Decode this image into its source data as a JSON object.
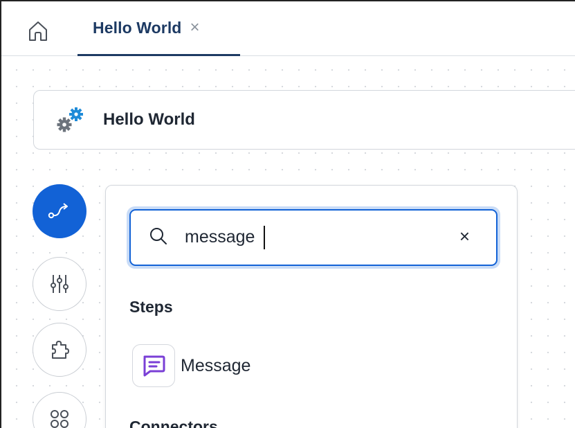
{
  "tabs": {
    "home_icon": "home-icon",
    "active_tab": {
      "label": "Hello World",
      "close": "×"
    }
  },
  "flow": {
    "icon": "cogs-icon",
    "title": "Hello World"
  },
  "rail": {
    "items": [
      {
        "icon": "flow-path-icon",
        "active": true
      },
      {
        "icon": "sliders-icon",
        "active": false
      },
      {
        "icon": "puzzle-icon",
        "active": false
      },
      {
        "icon": "apps-grid-icon",
        "active": false
      }
    ]
  },
  "search": {
    "value": "message",
    "clear": "×"
  },
  "sections": {
    "steps": "Steps",
    "connectors": "Connectors"
  },
  "results": {
    "steps": [
      {
        "label": "Message",
        "icon": "message-icon"
      }
    ]
  },
  "colors": {
    "primary": "#1262d6",
    "tab_text": "#1d3a63",
    "message_icon": "#7a3fd6",
    "gear_blue": "#1f8bd8",
    "gear_gray": "#6c737c"
  }
}
